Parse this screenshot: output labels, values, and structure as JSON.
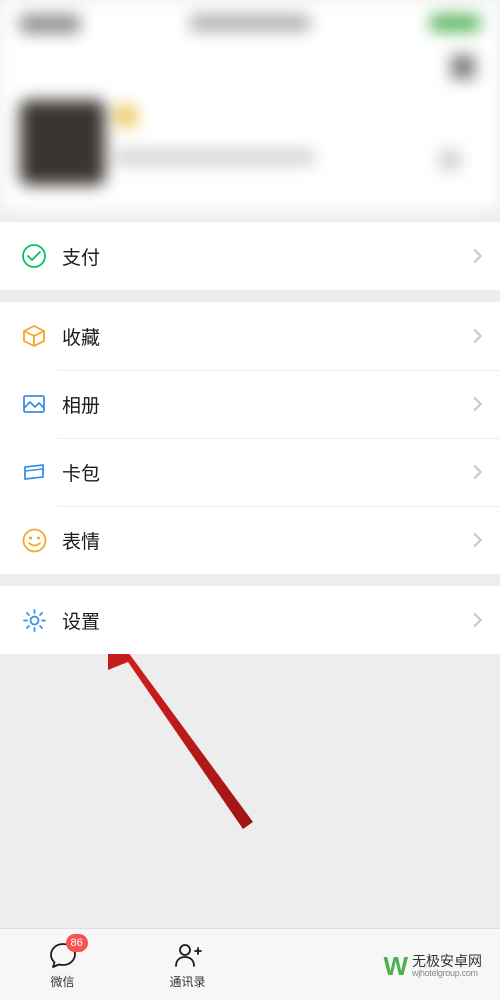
{
  "menu": {
    "pay": {
      "label": "支付"
    },
    "favorites": {
      "label": "收藏"
    },
    "album": {
      "label": "相册"
    },
    "cards": {
      "label": "卡包"
    },
    "sticker": {
      "label": "表情"
    },
    "settings": {
      "label": "设置"
    }
  },
  "tabs": {
    "wechat": {
      "label": "微信",
      "badge": "86"
    },
    "contacts": {
      "label": "通讯录"
    }
  },
  "watermark": {
    "title": "无极安卓网",
    "url": "wjhotelgroup.com"
  },
  "colors": {
    "icon_green": "#07c160",
    "icon_blue": "#3a8fe6",
    "icon_orange": "#f5a623",
    "badge_red": "#fa5151"
  }
}
